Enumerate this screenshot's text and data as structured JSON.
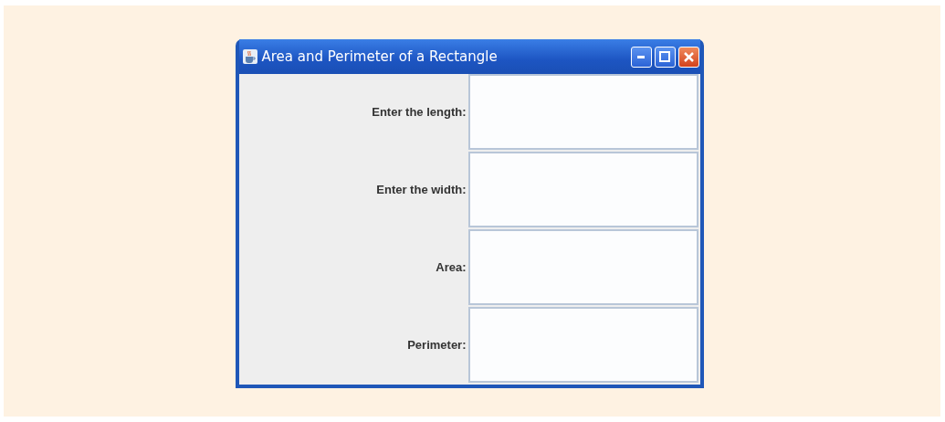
{
  "window": {
    "title": "Area and Perimeter of a Rectangle"
  },
  "rows": [
    {
      "label": "Enter the length:"
    },
    {
      "label": "Enter the width:"
    },
    {
      "label": "Area:"
    },
    {
      "label": "Perimeter:"
    }
  ]
}
